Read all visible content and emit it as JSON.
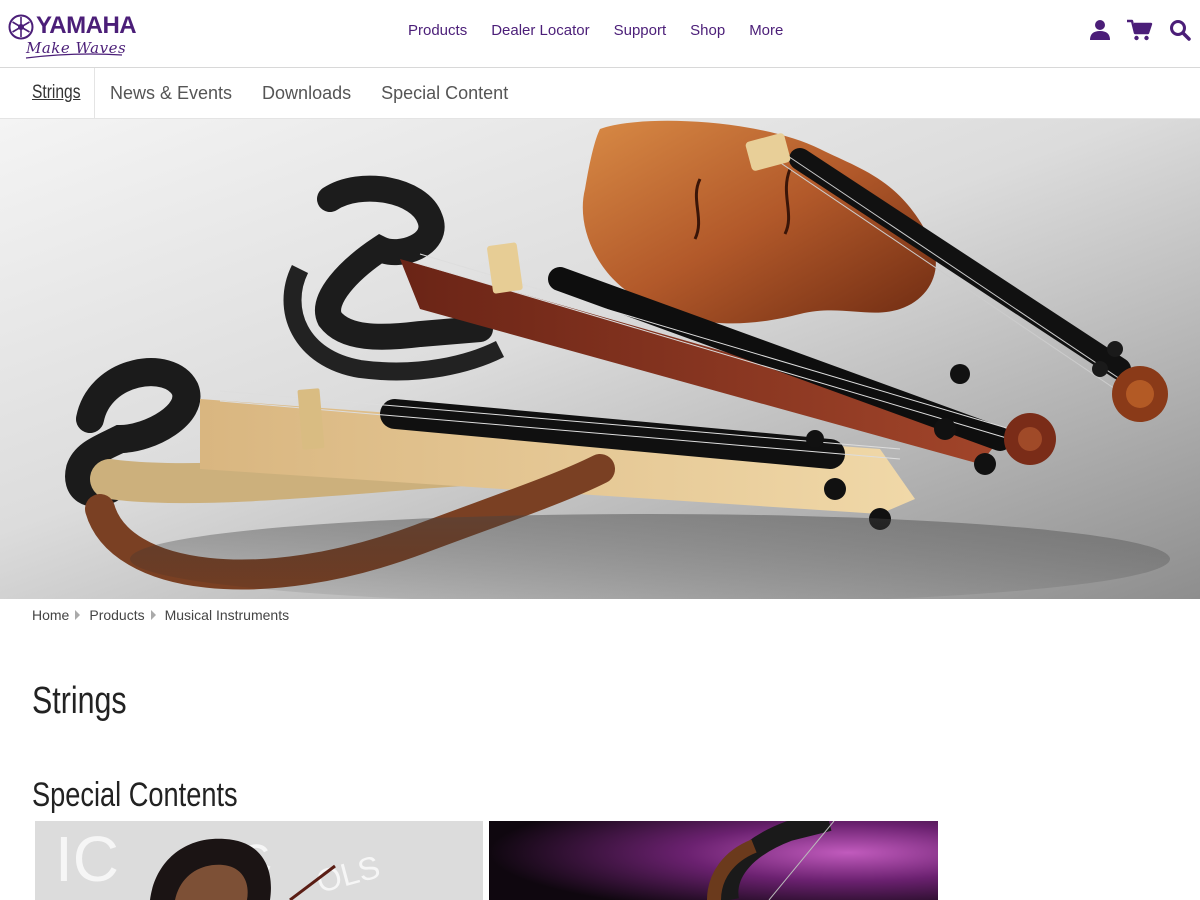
{
  "brand": {
    "name": "YAMAHA",
    "tagline": "Make Waves",
    "color": "#4b1e78"
  },
  "main_nav": {
    "items": [
      {
        "label": "Products"
      },
      {
        "label": "Dealer Locator"
      },
      {
        "label": "Support"
      },
      {
        "label": "Shop"
      },
      {
        "label": "More"
      }
    ]
  },
  "utility_icons": [
    "user-icon",
    "cart-icon",
    "search-icon"
  ],
  "sub_nav": {
    "current": "Strings",
    "tabs": [
      {
        "label": "News & Events"
      },
      {
        "label": "Downloads"
      },
      {
        "label": "Special Content"
      }
    ]
  },
  "breadcrumb": {
    "items": [
      {
        "label": "Home"
      },
      {
        "label": "Products"
      },
      {
        "label": "Musical Instruments"
      }
    ]
  },
  "page": {
    "title": "Strings",
    "section_title": "Special Contents"
  },
  "cards": [
    {
      "name": "special-content-card-1",
      "banner_text": "IC SC OLS"
    },
    {
      "name": "special-content-card-2"
    }
  ]
}
